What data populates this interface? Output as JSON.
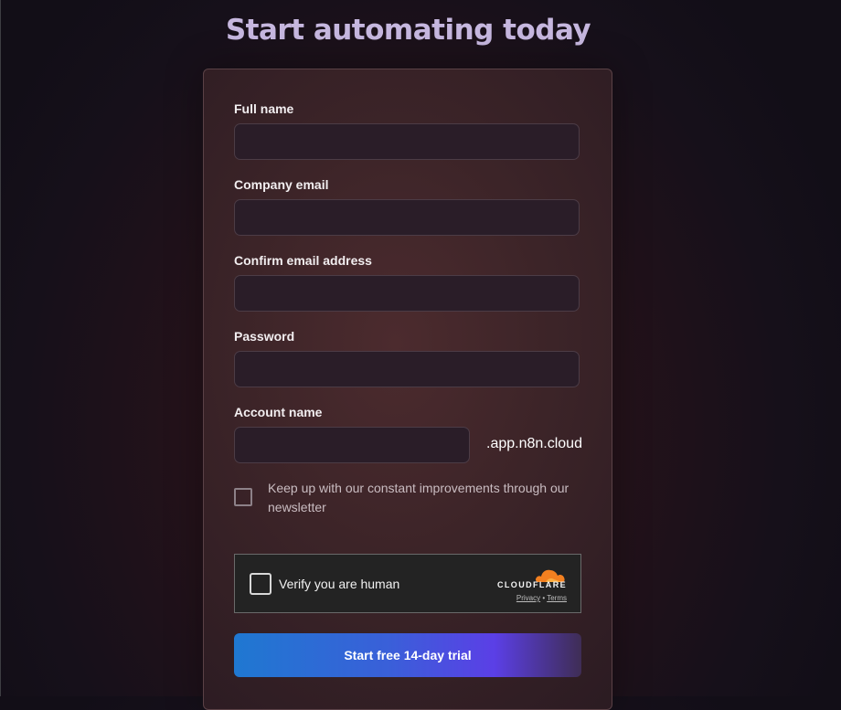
{
  "page": {
    "title": "Start automating today"
  },
  "form": {
    "full_name_label": "Full name",
    "company_email_label": "Company email",
    "confirm_email_label": "Confirm email address",
    "password_label": "Password",
    "account_name_label": "Account name",
    "account_domain_suffix": ".app.n8n.cloud",
    "newsletter_label": "Keep up with our constant improvements through our newsletter"
  },
  "captcha": {
    "label": "Verify you are human",
    "brand": "CLOUDFLARE",
    "privacy_link": "Privacy",
    "separator": "•",
    "terms_link": "Terms",
    "logo_color": "#f38020"
  },
  "cta": {
    "label": "Start free 14-day trial"
  },
  "colors": {
    "title": "#c6b7df",
    "button_start": "#1f78d1",
    "button_end": "#5b3fe6"
  }
}
